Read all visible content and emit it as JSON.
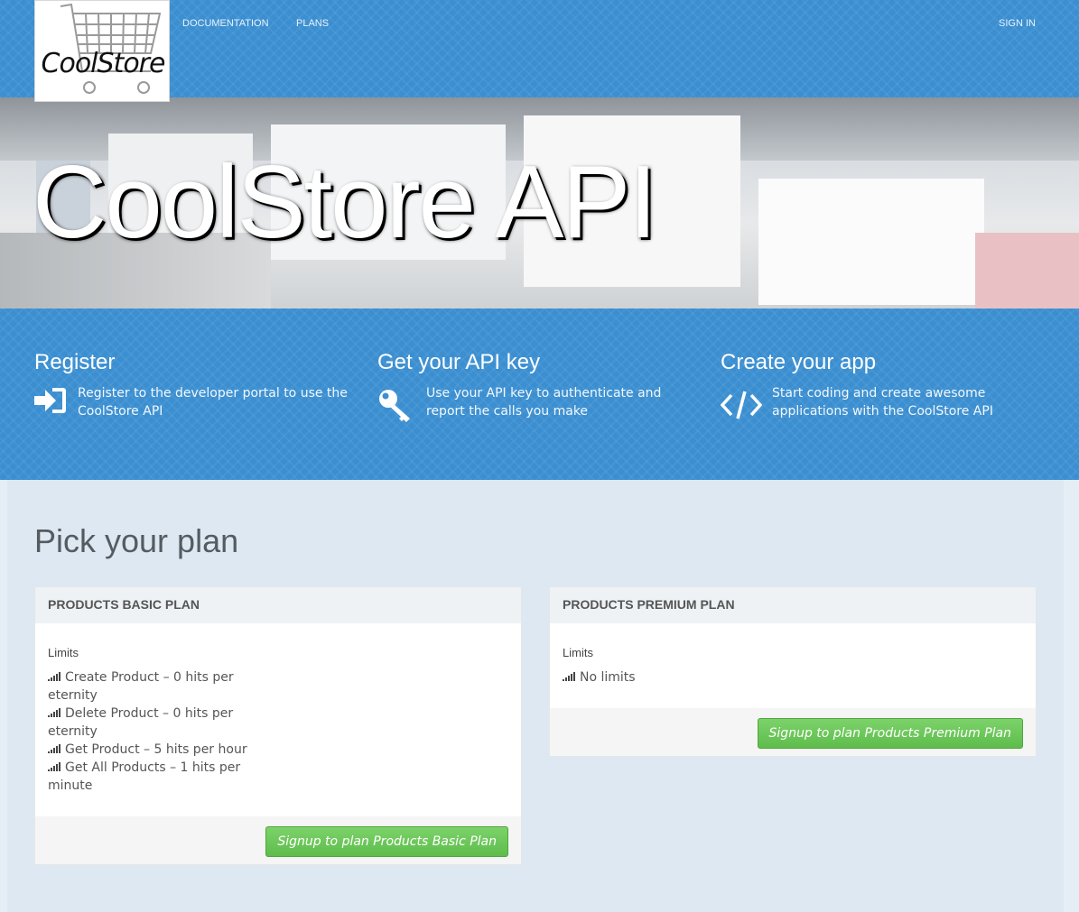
{
  "header": {
    "logo_text": "CoolStore",
    "nav": [
      "DOCUMENTATION",
      "PLANS"
    ],
    "sign_in": "SIGN IN"
  },
  "hero": {
    "title": "CoolStore API"
  },
  "features": [
    {
      "title": "Register",
      "text": "Register to the developer portal to use the CoolStore API",
      "icon": "sign-in-icon"
    },
    {
      "title": "Get your API key",
      "text": "Use your API key to authenticate and report the calls you make",
      "icon": "key-icon"
    },
    {
      "title": "Create your app",
      "text": "Start coding and create awesome applications with the CoolStore API",
      "icon": "code-icon"
    }
  ],
  "plans_section": {
    "title": "Pick your plan"
  },
  "plans": [
    {
      "name": "PRODUCTS BASIC PLAN",
      "limits_label": "Limits",
      "limits": [
        "Create Product – 0 hits per eternity",
        "Delete Product – 0 hits per eternity",
        "Get Product – 5 hits per hour",
        "Get All Products – 1 hits per minute"
      ],
      "button": "Signup to plan Products Basic Plan"
    },
    {
      "name": "PRODUCTS PREMIUM PLAN",
      "limits_label": "Limits",
      "limits": [
        "No limits"
      ],
      "button": "Signup to plan Products Premium Plan"
    }
  ],
  "colors": {
    "brand_blue": "#3b8fd1",
    "button_green": "#5fbd4c"
  }
}
